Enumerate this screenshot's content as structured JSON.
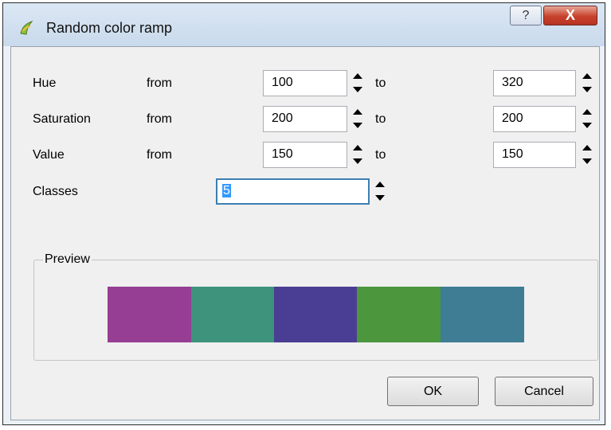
{
  "window": {
    "title": "Random color ramp",
    "help": "?",
    "close": "X"
  },
  "rows": [
    {
      "label": "Hue",
      "from_label": "from",
      "from_value": "100",
      "to_label": "to",
      "to_value": "320"
    },
    {
      "label": "Saturation",
      "from_label": "from",
      "from_value": "200",
      "to_label": "to",
      "to_value": "200"
    },
    {
      "label": "Value",
      "from_label": "from",
      "from_value": "150",
      "to_label": "to",
      "to_value": "150"
    }
  ],
  "classes": {
    "label": "Classes",
    "value": "5"
  },
  "preview": {
    "title": "Preview",
    "swatches": [
      "#953e94",
      "#3d937c",
      "#4a3e94",
      "#4c963e",
      "#3e7d94"
    ]
  },
  "buttons": {
    "ok": "OK",
    "cancel": "Cancel"
  }
}
